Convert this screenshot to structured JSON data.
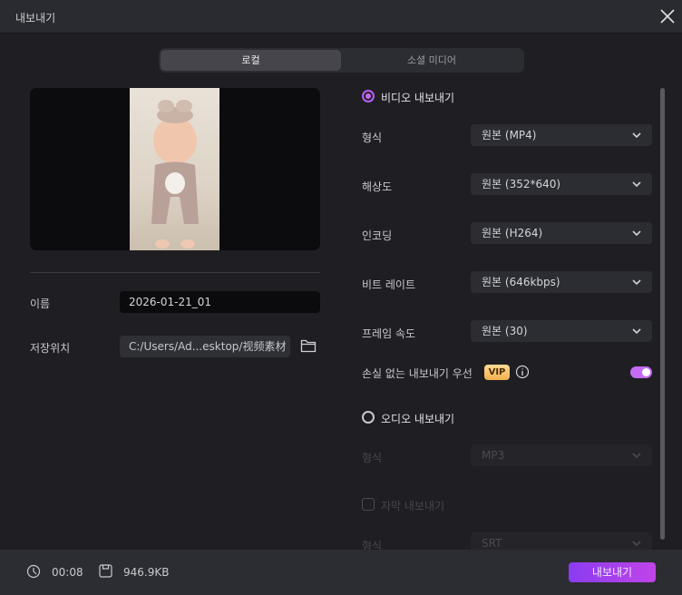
{
  "window": {
    "title": "내보내기"
  },
  "tabs": [
    {
      "label": "로컬",
      "active": true
    },
    {
      "label": "소셜 미디어",
      "active": false
    }
  ],
  "left": {
    "name_label": "이름",
    "name_value": "2026-01-21_01",
    "location_label": "저장위치",
    "location_value": "C:/Users/Ad...esktop/视频素材"
  },
  "video": {
    "section_label": "비디오 내보내기",
    "selected": true,
    "rows": [
      {
        "label": "형식",
        "value": "원본 (MP4)"
      },
      {
        "label": "해상도",
        "value": "원본 (352*640)"
      },
      {
        "label": "인코딩",
        "value": "원본 (H264)"
      },
      {
        "label": "비트 레이트",
        "value": "원본 (646kbps)"
      },
      {
        "label": "프레임 속도",
        "value": "원본 (30)"
      }
    ],
    "lossless_label": "손실 없는 내보내기 우선",
    "vip_badge": "VIP",
    "lossless_on": true
  },
  "audio": {
    "section_label": "오디오 내보내기",
    "selected": false,
    "format_label": "형식",
    "format_value": "MP3"
  },
  "subtitle": {
    "section_label": "자막 내보내기",
    "checked": false,
    "format_label": "형식",
    "format_value": "SRT"
  },
  "footer": {
    "duration": "00:08",
    "size": "946.9KB",
    "export_label": "내보내기"
  },
  "colors": {
    "accent": "#c46cf5",
    "button_start": "#8a3cf0",
    "button_end": "#c044e8",
    "background": "#1f1f23"
  }
}
